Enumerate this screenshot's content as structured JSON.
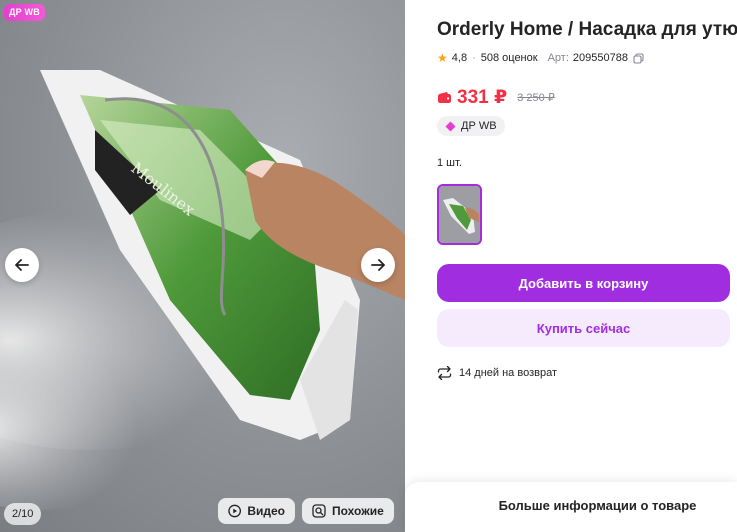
{
  "gallery": {
    "badge": "ДР WB",
    "counter": "2/10",
    "video_label": "Видео",
    "similar_label": "Похожие"
  },
  "product": {
    "title": "Orderly Home / Насадка для утюга",
    "rating": "4,8",
    "reviews": "508 оценок",
    "article_label": "Арт:",
    "article": "209550788",
    "price": "331 ₽",
    "old_price": "3 250 ₽",
    "promo_tag": "ДР WB",
    "quantity": "1 шт.",
    "brand_print": "Moulinex"
  },
  "actions": {
    "add_to_cart": "Добавить в корзину",
    "buy_now": "Купить сейчас"
  },
  "returns": "14 дней на возврат",
  "more_info": "Больше информации о товаре",
  "colors": {
    "accent": "#a12de0",
    "price": "#f23046",
    "promo": "#e43fcf",
    "star": "#ff9f1c"
  }
}
